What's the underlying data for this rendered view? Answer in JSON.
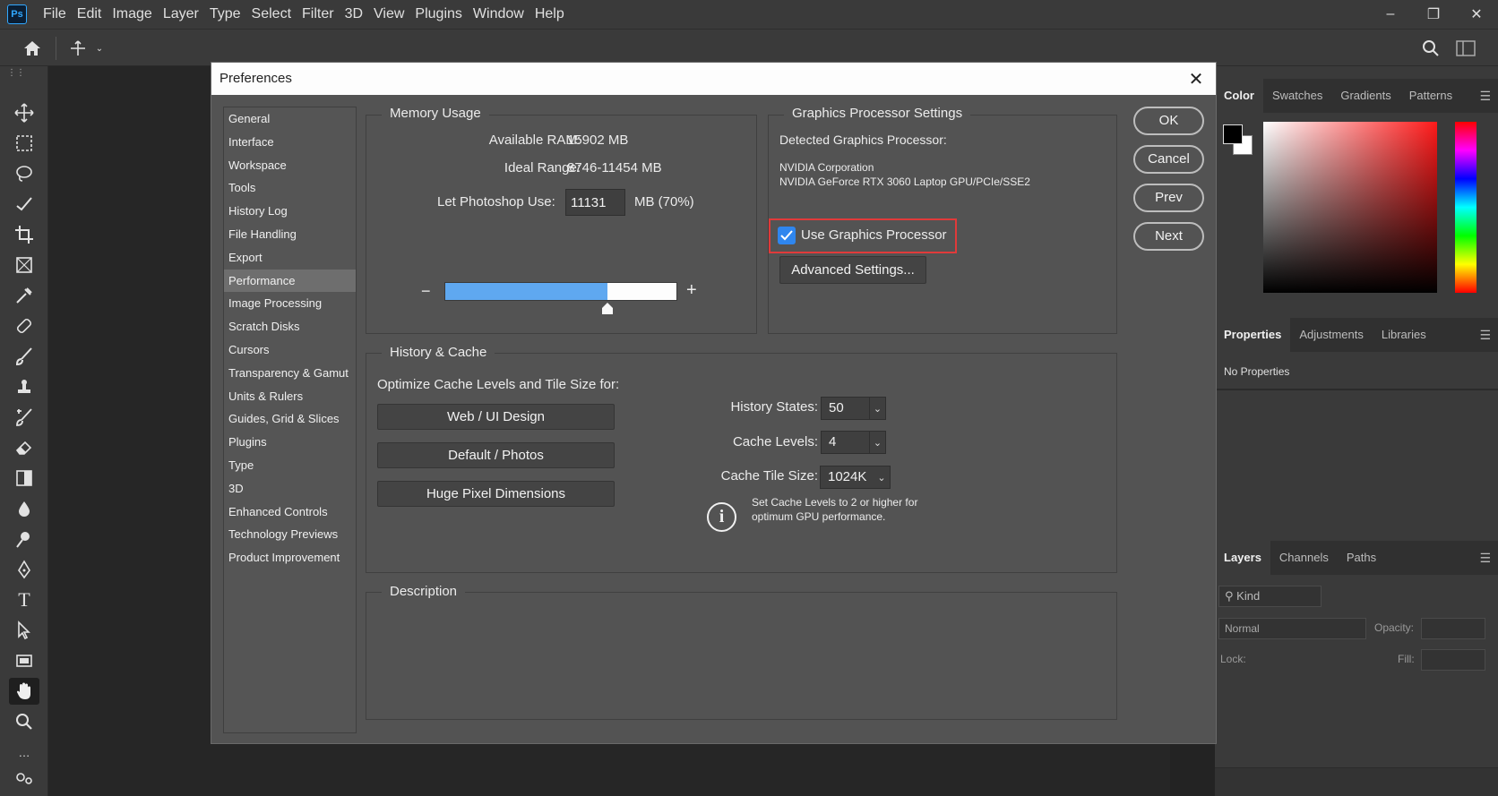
{
  "app": {
    "logo": "Ps",
    "menu": [
      "File",
      "Edit",
      "Image",
      "Layer",
      "Type",
      "Select",
      "Filter",
      "3D",
      "View",
      "Plugins",
      "Window",
      "Help"
    ]
  },
  "dialog": {
    "title": "Preferences",
    "sidebar": [
      "General",
      "Interface",
      "Workspace",
      "Tools",
      "History Log",
      "File Handling",
      "Export",
      "Performance",
      "Image Processing",
      "Scratch Disks",
      "Cursors",
      "Transparency & Gamut",
      "Units & Rulers",
      "Guides, Grid & Slices",
      "Plugins",
      "Type",
      "3D",
      "Enhanced Controls",
      "Technology Previews",
      "Product Improvement"
    ],
    "selected_item": "Performance",
    "memory": {
      "title": "Memory Usage",
      "available_label": "Available RAM:",
      "available_value": "15902 MB",
      "ideal_label": "Ideal Range:",
      "ideal_value": "8746-11454 MB",
      "use_label": "Let Photoshop Use:",
      "use_value": "11131",
      "use_suffix": "MB (70%)",
      "slider_fraction": 0.7,
      "minus": "−",
      "plus": "+"
    },
    "gpu": {
      "title": "Graphics Processor Settings",
      "detected_label": "Detected Graphics Processor:",
      "vendor": "NVIDIA Corporation",
      "model": "NVIDIA GeForce RTX 3060 Laptop GPU/PCIe/SSE2",
      "use_gpu_label": "Use Graphics Processor",
      "use_gpu_checked": true,
      "advanced_button": "Advanced Settings..."
    },
    "history": {
      "title": "History & Cache",
      "optimize_label": "Optimize Cache Levels and Tile Size for:",
      "preset_buttons": [
        "Web / UI Design",
        "Default / Photos",
        "Huge Pixel Dimensions"
      ],
      "history_states_label": "History States:",
      "history_states_value": "50",
      "cache_levels_label": "Cache Levels:",
      "cache_levels_value": "4",
      "tile_size_label": "Cache Tile Size:",
      "tile_size_value": "1024K",
      "info_line1": "Set Cache Levels to 2 or higher for",
      "info_line2": "optimum GPU performance."
    },
    "description": {
      "title": "Description"
    },
    "buttons": {
      "ok": "OK",
      "cancel": "Cancel",
      "prev": "Prev",
      "next": "Next"
    }
  },
  "panels": {
    "color_tabs": [
      "Color",
      "Swatches",
      "Gradients",
      "Patterns"
    ],
    "properties_tabs": [
      "Properties",
      "Adjustments",
      "Libraries"
    ],
    "properties_text": "No Properties",
    "layers_tabs": [
      "Layers",
      "Channels",
      "Paths"
    ],
    "kind_label": "Kind",
    "blend_mode": "Normal",
    "opacity_label": "Opacity:",
    "lock_label": "Lock:",
    "fill_label": "Fill:"
  },
  "colors": {
    "accent": "#2f86ee",
    "slider_blue": "#5fa8f0",
    "highlight": "#e03a3a"
  }
}
